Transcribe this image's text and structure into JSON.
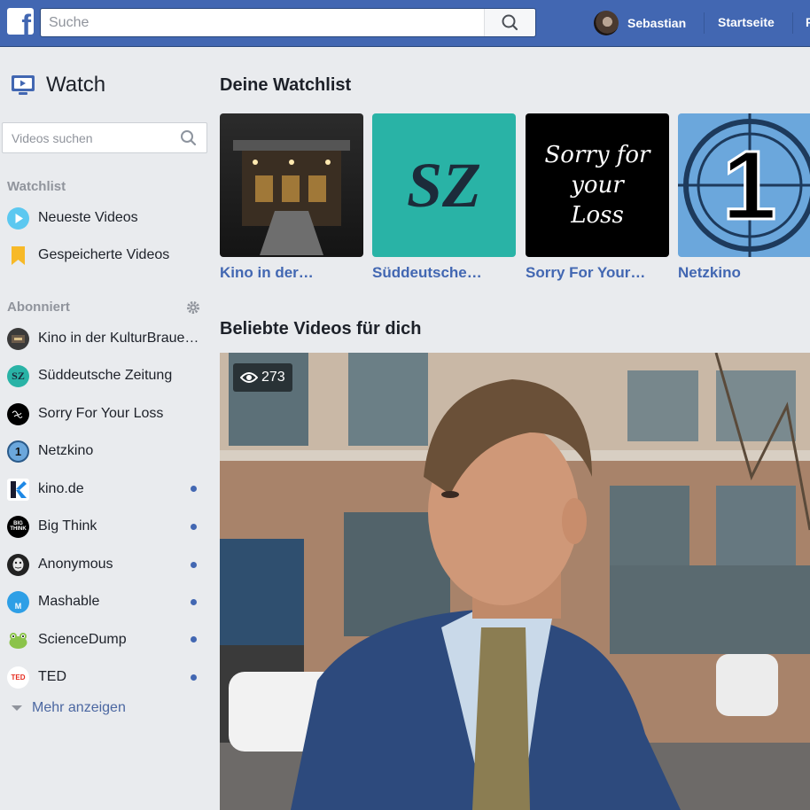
{
  "header": {
    "logo": "f",
    "search_placeholder": "Suche",
    "user_name": "Sebastian",
    "nav_home": "Startseite",
    "nav_cut": "F"
  },
  "sidebar": {
    "title": "Watch",
    "search_placeholder": "Videos suchen",
    "watchlist_label": "Watchlist",
    "watchlist_items": [
      {
        "label": "Neueste Videos",
        "icon": "play-icon"
      },
      {
        "label": "Gespeicherte Videos",
        "icon": "bookmark-icon"
      }
    ],
    "subscribed_label": "Abonniert",
    "subscribed_items": [
      {
        "label": "Kino in der KulturBraue…",
        "icon_text": "",
        "unread": false,
        "color": "#3a3a3a"
      },
      {
        "label": "Süddeutsche Zeitung",
        "icon_text": "SZ",
        "unread": false,
        "color": "#29b3a6"
      },
      {
        "label": "Sorry For Your Loss",
        "icon_text": "",
        "unread": false,
        "color": "#000000"
      },
      {
        "label": "Netzkino",
        "icon_text": "1",
        "unread": false,
        "color": "#6ba7dc"
      },
      {
        "label": "kino.de",
        "icon_text": "",
        "unread": true,
        "color": "#ffffff"
      },
      {
        "label": "Big Think",
        "icon_text": "BIG THINK",
        "unread": true,
        "color": "#000000"
      },
      {
        "label": "Anonymous",
        "icon_text": "",
        "unread": true,
        "color": "#222222"
      },
      {
        "label": "Mashable",
        "icon_text": "M",
        "unread": true,
        "color": "#2e9fe6"
      },
      {
        "label": "ScienceDump",
        "icon_text": "",
        "unread": true,
        "color": "#8bc34a"
      },
      {
        "label": "TED",
        "icon_text": "TED",
        "unread": true,
        "color": "#ffffff"
      }
    ],
    "more_label": "Mehr anzeigen"
  },
  "main": {
    "watchlist_heading": "Deine Watchlist",
    "watchlist_cards": [
      {
        "title": "Kino in der…"
      },
      {
        "title": "Süddeutsche…",
        "logo_text": "SZ"
      },
      {
        "title": "Sorry For Your…",
        "logo_text": "Sorry for your Loss"
      },
      {
        "title": "Netzkino",
        "logo_text": "1"
      }
    ],
    "popular_heading": "Beliebte Videos für dich",
    "video": {
      "views": "273"
    }
  },
  "colors": {
    "brand": "#4267b2",
    "link": "#4267b2",
    "unread_dot": "#4267b2"
  }
}
